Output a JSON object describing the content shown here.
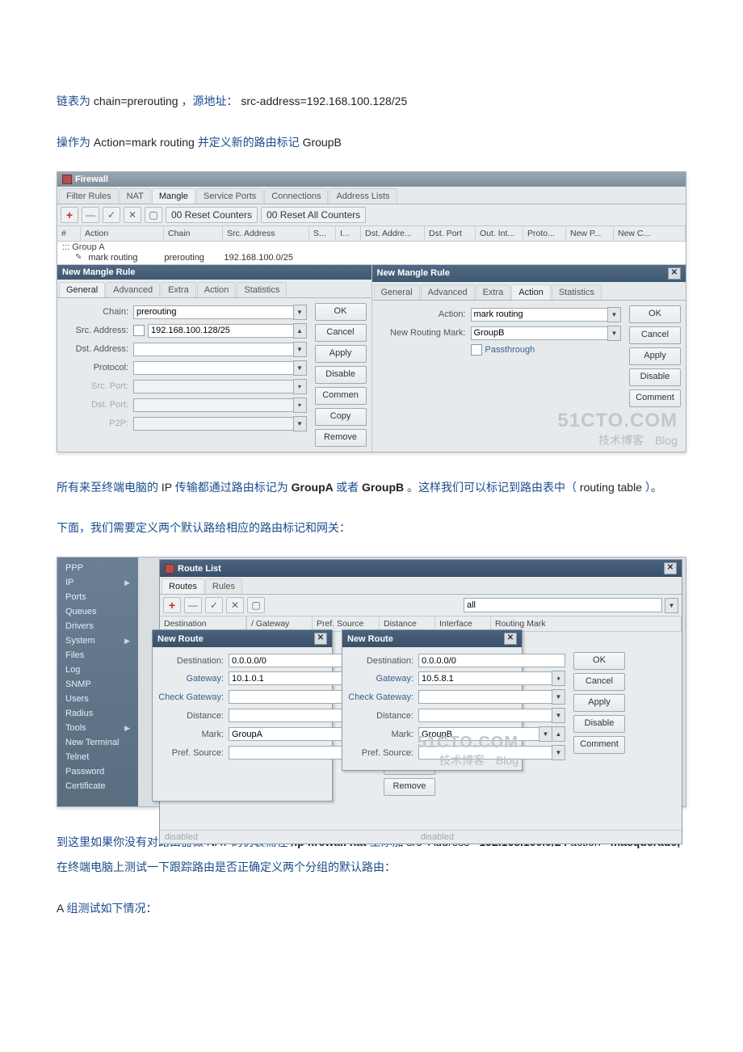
{
  "intro": {
    "p1_a": "链表为 ",
    "p1_b": "chain=prerouting",
    "p1_c": "，源地址：",
    "p1_d": "src-address=192.168.100.128/25",
    "p2_a": "操作为 ",
    "p2_b": "Action=mark routing ",
    "p2_c": "并定义新的路由标记 ",
    "p2_d": "GroupB"
  },
  "fw": {
    "title": "Firewall",
    "tabs": [
      "Filter Rules",
      "NAT",
      "Mangle",
      "Service Ports",
      "Connections",
      "Address Lists"
    ],
    "active_tab": 2,
    "toolbar": {
      "reset_counters": "00 Reset Counters",
      "reset_all": "00 Reset All Counters"
    },
    "columns": [
      "#",
      "Action",
      "Chain",
      "Src. Address",
      "S...",
      "I...",
      "Dst. Addre...",
      "Dst. Port",
      "Out. Int...",
      "Proto...",
      "New P...",
      "New C..."
    ],
    "group_label": "::: Group A",
    "row": {
      "action": "mark routing",
      "chain": "prerouting",
      "src": "192.168.100.0/25"
    },
    "dlgL": {
      "title": "New Mangle Rule",
      "tabs": [
        "General",
        "Advanced",
        "Extra",
        "Action",
        "Statistics"
      ],
      "chain_label": "Chain:",
      "chain_value": "prerouting",
      "src_label": "Src. Address:",
      "src_value": "192.168.100.128/25",
      "dst_label": "Dst. Address:",
      "proto_label": "Protocol:",
      "srcport_label": "Src. Port:",
      "dstport_label": "Dst. Port:",
      "p2p_label": "P2P:"
    },
    "dlgR": {
      "title": "New Mangle Rule",
      "tabs": [
        "General",
        "Advanced",
        "Extra",
        "Action",
        "Statistics"
      ],
      "action_label": "Action:",
      "action_value": "mark routing",
      "newmark_label": "New Routing Mark:",
      "newmark_value": "GroupB",
      "passthrough": "Passthrough"
    },
    "buttons": {
      "ok": "OK",
      "cancel": "Cancel",
      "apply": "Apply",
      "disable": "Disable",
      "comment": "Commen",
      "comment_full": "Comment",
      "copy": "Copy",
      "remove": "Remove"
    }
  },
  "mid": {
    "p1_a": "所有来至终端电脑的 ",
    "p1_b": "IP ",
    "p1_c": "传输都通过路由标记为 ",
    "p1_d": "GroupA ",
    "p1_e": "或者 ",
    "p1_f": "GroupB",
    "p1_g": "。这样我们可以标记到路由表中（",
    "p1_h": "routing table",
    "p1_i": "）。",
    "p2": "下面，我们需要定义两个默认路给相应的路由标记和网关："
  },
  "rt": {
    "sidebar": [
      "PPP",
      "IP",
      "Ports",
      "Queues",
      "Drivers",
      "System",
      "Files",
      "Log",
      "SNMP",
      "Users",
      "Radius",
      "Tools",
      "New Terminal",
      "Telnet",
      "Password",
      "Certificate"
    ],
    "sidebar_arrows": [
      1,
      5,
      11
    ],
    "win_title": "Route List",
    "tabs": [
      "Routes",
      "Rules"
    ],
    "columns": [
      "Destination",
      "Gateway",
      "Pref. Source",
      "Distance",
      "Interface",
      "Routing Mark"
    ],
    "filter_all": "all",
    "dlg": {
      "title": "New Route",
      "dest_label": "Destination:",
      "gw_label": "Gateway:",
      "chkgw_label": "Check Gateway:",
      "dist_label": "Distance:",
      "mark_label": "Mark:",
      "prefsrc_label": "Pref. Source:"
    },
    "dlgA": {
      "dest": "0.0.0.0/0",
      "gw": "10.1.0.1",
      "mark": "GroupA"
    },
    "dlgB": {
      "dest": "0.0.0.0/0",
      "gw": "10.5.8.1",
      "mark": "GroupB"
    },
    "status": "disabled"
  },
  "tail": {
    "p1_a": "到这里如果你没有对路由器做 ",
    "p1_b": "NAT ",
    "p1_c": "的伪装需在",
    "p1_d": "/ip firewall nat ",
    "p1_e": "里添加 ",
    "p1_f": "src- Address=",
    "p1_g": "192.168.100.0/24 ",
    "p1_h": "action=",
    "p1_i": "masquerade,",
    "p1_j": "在终端电脑上测试一下跟踪路由是否正确定义两个分组的默认路由：",
    "p2": "A 组测试如下情况："
  },
  "wm": {
    "l1": "51CTO.COM",
    "l2": "技术博客　Blog"
  }
}
